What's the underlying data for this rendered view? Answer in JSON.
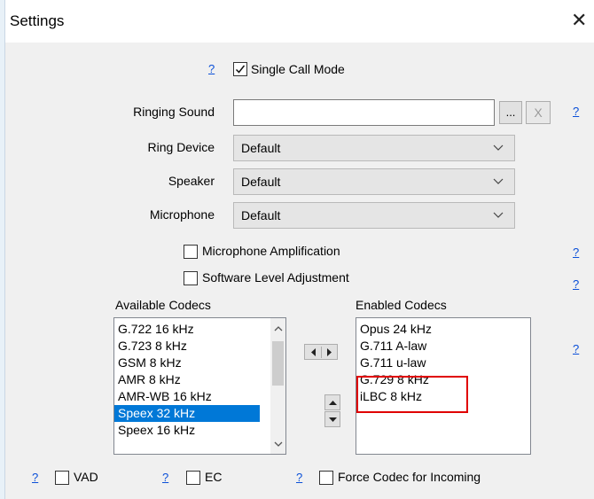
{
  "window": {
    "title": "Settings",
    "close_glyph": "✕"
  },
  "help_glyph": "?",
  "single_call_mode": {
    "label": "Single Call Mode",
    "checked": true
  },
  "ringing_sound": {
    "label": "Ringing Sound",
    "value": "",
    "browse": "...",
    "clear": "X"
  },
  "ring_device": {
    "label": "Ring Device",
    "value": "Default"
  },
  "speaker": {
    "label": "Speaker",
    "value": "Default"
  },
  "microphone": {
    "label": "Microphone",
    "value": "Default"
  },
  "mic_amplification": {
    "label": "Microphone Amplification",
    "checked": false
  },
  "software_level": {
    "label": "Software Level Adjustment",
    "checked": false
  },
  "available_codecs": {
    "header": "Available Codecs",
    "items": [
      "G.722 16 kHz",
      "G.723 8 kHz",
      "GSM 8 kHz",
      "AMR 8 kHz",
      "AMR-WB 16 kHz",
      "Speex 32 kHz",
      "Speex 16 kHz"
    ],
    "selected_index": 5
  },
  "enabled_codecs": {
    "header": "Enabled Codecs",
    "items": [
      "Opus 24 kHz",
      "G.711 A-law",
      "G.711 u-law",
      "G.729 8 kHz",
      "iLBC 8 kHz"
    ]
  },
  "vad": {
    "label": "VAD",
    "checked": false
  },
  "ec": {
    "label": "EC",
    "checked": false
  },
  "force_codec": {
    "label": "Force Codec for Incoming",
    "checked": false
  },
  "colors": {
    "accent": "#0078d7",
    "help_link": "#0a4fd8",
    "highlight": "#e00000"
  }
}
